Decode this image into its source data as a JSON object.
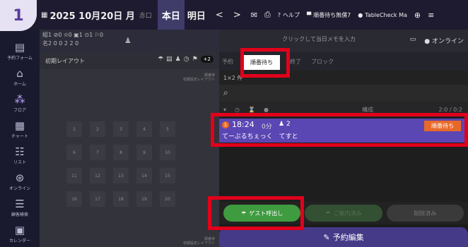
{
  "step_badge": "1",
  "topbar": {
    "date": "2025 10月20日 月",
    "dim_text": "赤口",
    "today": "本日",
    "tomorrow": "明日",
    "prev": "<",
    "next": ">",
    "help": "ヘルプ",
    "waitlist_off": "順番待ち無償7",
    "account": "TableCheck Ma"
  },
  "sidebar": {
    "items": [
      {
        "icon": "clipboard-icon",
        "glyph": "▤",
        "label": "予約フォーム"
      },
      {
        "icon": "home-icon",
        "glyph": "⌂",
        "label": "ホーム"
      },
      {
        "icon": "floor-icon",
        "glyph": "⁂",
        "label": "フロア"
      },
      {
        "icon": "chart-icon",
        "glyph": "▦",
        "label": "チャート"
      },
      {
        "icon": "list-icon",
        "glyph": "☷",
        "label": "リスト"
      },
      {
        "icon": "online-icon",
        "glyph": "⊛",
        "label": "オンライン"
      },
      {
        "icon": "customer-icon",
        "glyph": "☰",
        "label": "顧客検索"
      },
      {
        "icon": "calendar-icon",
        "glyph": "▣",
        "label": "カレンダー"
      }
    ]
  },
  "counters": {
    "line1": "組1 ⊘0 ✫0 ▣1 ⊙1 ⚐0",
    "line2": "名2  0  0  2  2  0"
  },
  "layout": {
    "tab": "初期レイアウト",
    "extra": "+2",
    "note_label": "順番待",
    "note_sub": "初期設定レイアウト"
  },
  "floor": {
    "tables": [
      "1",
      "2",
      "3",
      "4",
      "5",
      "6",
      "7",
      "8",
      "9",
      "10",
      "11",
      "12",
      "13",
      "14",
      "15",
      "16",
      "17",
      "18",
      "19",
      "20"
    ]
  },
  "memo": {
    "placeholder": "クリックして当日メモを入力",
    "online": "オンライン"
  },
  "tabs": [
    {
      "label": "予約",
      "active": false
    },
    {
      "label": "順番待ち",
      "active": true
    },
    {
      "label": "終了",
      "active": false
    },
    {
      "label": "ブロック",
      "active": false
    }
  ],
  "subbar": {
    "text": "1×2 件"
  },
  "list": {
    "col_name": "構成",
    "col_time": "2:0 / 0:2"
  },
  "reservation": {
    "number": "1",
    "time": "18:24",
    "minutes": "0分",
    "party": "2",
    "name": "てーぶるちぇっく　てすと",
    "status": "順番待ち"
  },
  "actions": {
    "call_guest": "ゲスト呼出し",
    "seated": "ご案内済み",
    "delete": "削除済み",
    "edit": "予約編集"
  },
  "colors": {
    "accent": "#5b47b3",
    "highlight": "#e2001a",
    "green": "#3f9b3f",
    "orange": "#e8682a"
  }
}
